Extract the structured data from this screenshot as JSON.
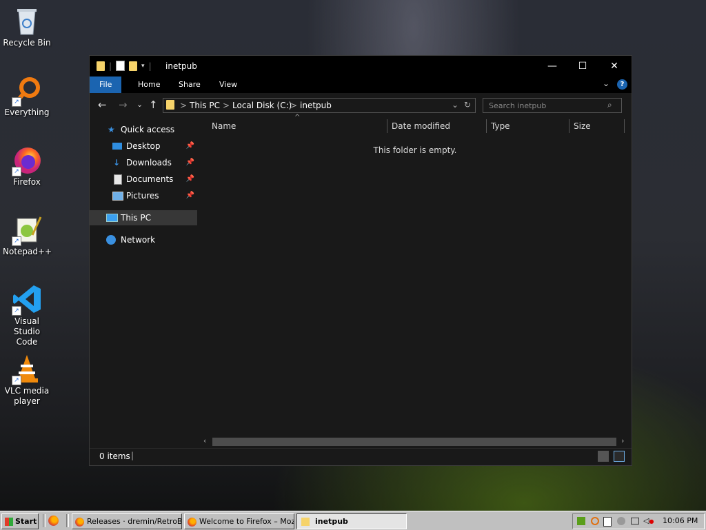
{
  "desktop": {
    "icons": [
      {
        "label": "Recycle Bin"
      },
      {
        "label": "Everything"
      },
      {
        "label": "Firefox"
      },
      {
        "label": "Notepad++"
      },
      {
        "label": "Visual Studio\nCode"
      },
      {
        "label": "VLC media\nplayer"
      }
    ]
  },
  "explorer": {
    "title": "inetpub",
    "ribbon_tabs": [
      "File",
      "Home",
      "Share",
      "View"
    ],
    "address": {
      "crumbs": [
        "This PC",
        "Local Disk (C:)",
        "inetpub"
      ],
      "separator": ">"
    },
    "search": {
      "placeholder": "Search inetpub"
    },
    "nav": {
      "quick_access": "Quick access",
      "pinned": [
        "Desktop",
        "Downloads",
        "Documents",
        "Pictures"
      ],
      "this_pc": "This PC",
      "network": "Network"
    },
    "columns": [
      "Name",
      "Date modified",
      "Type",
      "Size"
    ],
    "empty_message": "This folder is empty.",
    "status": {
      "items": "0 items"
    }
  },
  "taskbar": {
    "start_label": "Start",
    "buttons": [
      {
        "label": "Releases · dremin/RetroB..."
      },
      {
        "label": "Welcome to Firefox – Mozi..."
      },
      {
        "label": "inetpub",
        "active": true
      }
    ],
    "clock": "10:06 PM"
  },
  "colors": {
    "accent": "#1b64b0",
    "window_bg": "#191919",
    "titlebar": "#000000",
    "folder": "#f6d36a"
  }
}
